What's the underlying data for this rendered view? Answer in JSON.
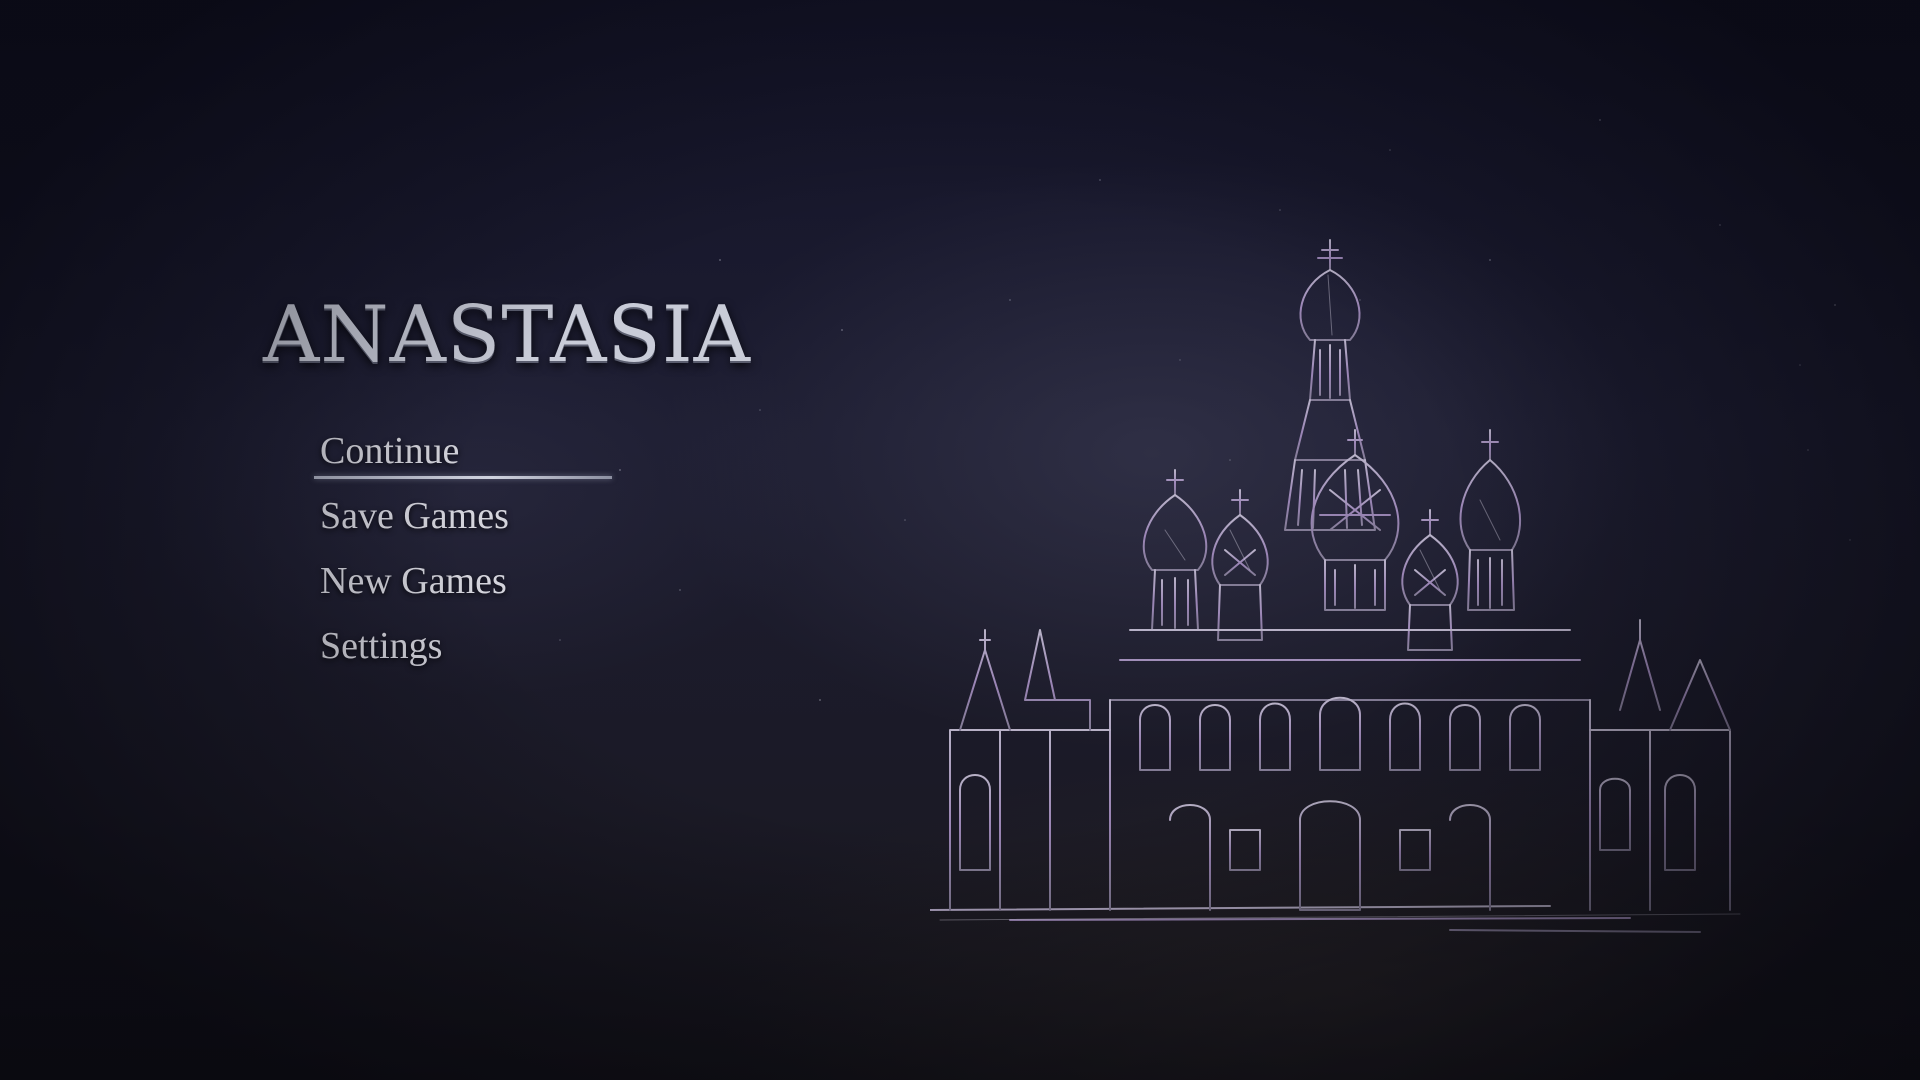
{
  "title": "ANASTASIA",
  "menu": {
    "items": [
      {
        "label": "Continue",
        "selected": true
      },
      {
        "label": "Save Games",
        "selected": false
      },
      {
        "label": "New Games",
        "selected": false
      },
      {
        "label": "Settings",
        "selected": false
      }
    ]
  },
  "artwork": {
    "subject": "cathedral-sketch",
    "line_color": "#a08ab8",
    "line_color_light": "#c9c2d8"
  },
  "colors": {
    "background": "#1a1a2c",
    "text": "#d4d4dc",
    "highlight": "#c6c9d8"
  }
}
